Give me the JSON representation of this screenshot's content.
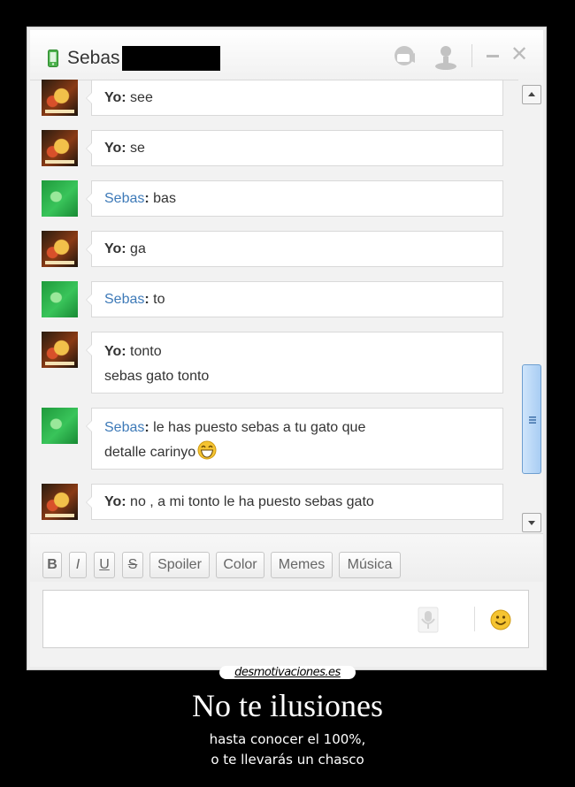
{
  "window": {
    "contact_name": "Sebas"
  },
  "messages": [
    {
      "author": "yo",
      "sender": "Yo",
      "lines": [
        "see"
      ],
      "emoticon": false
    },
    {
      "author": "yo",
      "sender": "Yo",
      "lines": [
        "se"
      ],
      "emoticon": false
    },
    {
      "author": "sebas",
      "sender": "Sebas",
      "lines": [
        "bas"
      ],
      "emoticon": false
    },
    {
      "author": "yo",
      "sender": "Yo",
      "lines": [
        "ga"
      ],
      "emoticon": false
    },
    {
      "author": "sebas",
      "sender": "Sebas",
      "lines": [
        "to"
      ],
      "emoticon": false
    },
    {
      "author": "yo",
      "sender": "Yo",
      "lines": [
        "tonto",
        "sebas gato tonto"
      ],
      "emoticon": false
    },
    {
      "author": "sebas",
      "sender": "Sebas",
      "lines": [
        "le has puesto sebas a tu gato que",
        "detalle carinyo"
      ],
      "emoticon": true
    },
    {
      "author": "yo",
      "sender": "Yo",
      "lines": [
        "no , a mi tonto le ha puesto sebas gato"
      ],
      "emoticon": false
    },
    {
      "author": "yo",
      "sender": "",
      "lines": [
        ""
      ],
      "emoticon": false
    }
  ],
  "toolbar": {
    "bold": "B",
    "italic": "I",
    "underline": "U",
    "strike": "S",
    "spoiler": "Spoiler",
    "color": "Color",
    "memes": "Memes",
    "music": "Música"
  },
  "composer": {
    "placeholder": ""
  },
  "poster": {
    "watermark": "desmotivaciones.es",
    "title": "No te ilusiones",
    "subtitle_line1": "hasta conocer el 100%,",
    "subtitle_line2": "o te llevarás un chasco"
  },
  "colors": {
    "sebas_name": "#3e7ab8",
    "scroll_thumb": "#a8cdf3",
    "emoticon": "#f5c431"
  }
}
